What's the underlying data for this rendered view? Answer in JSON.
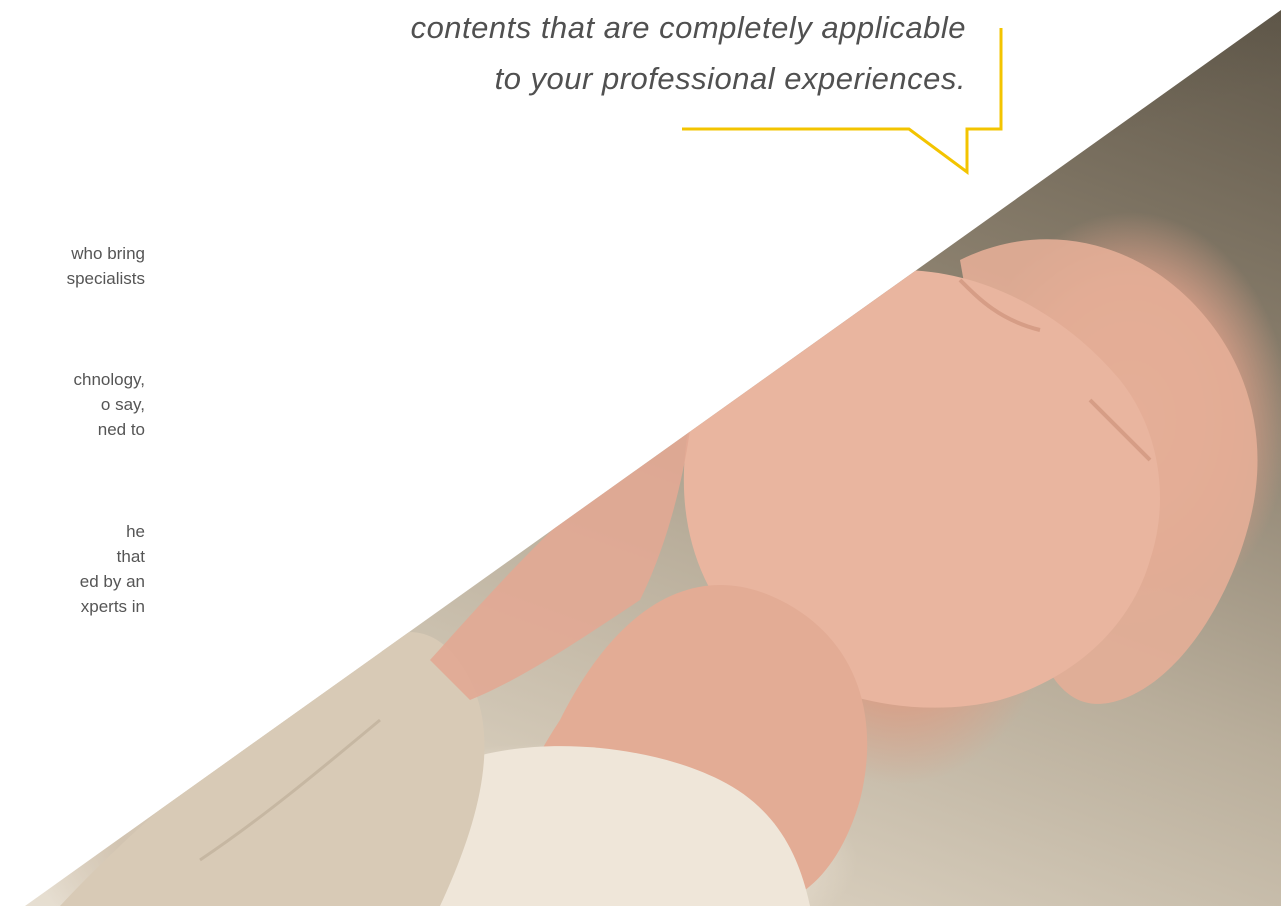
{
  "quote": {
    "line1": "contents that are completely applicable",
    "line2": "to your professional experiences."
  },
  "paragraphs": [
    {
      "lines": [
        "who bring",
        "specialists"
      ]
    },
    {
      "lines": [
        "chnology,",
        "o say,",
        "ned to"
      ]
    },
    {
      "lines": [
        "he",
        "that",
        "ed by an",
        "xperts in"
      ]
    }
  ],
  "photo": {
    "subject": "two-hands-clasped"
  },
  "colors": {
    "accent_yellow": "#f3c400",
    "quote_text": "#505050",
    "body_text": "#555555"
  }
}
